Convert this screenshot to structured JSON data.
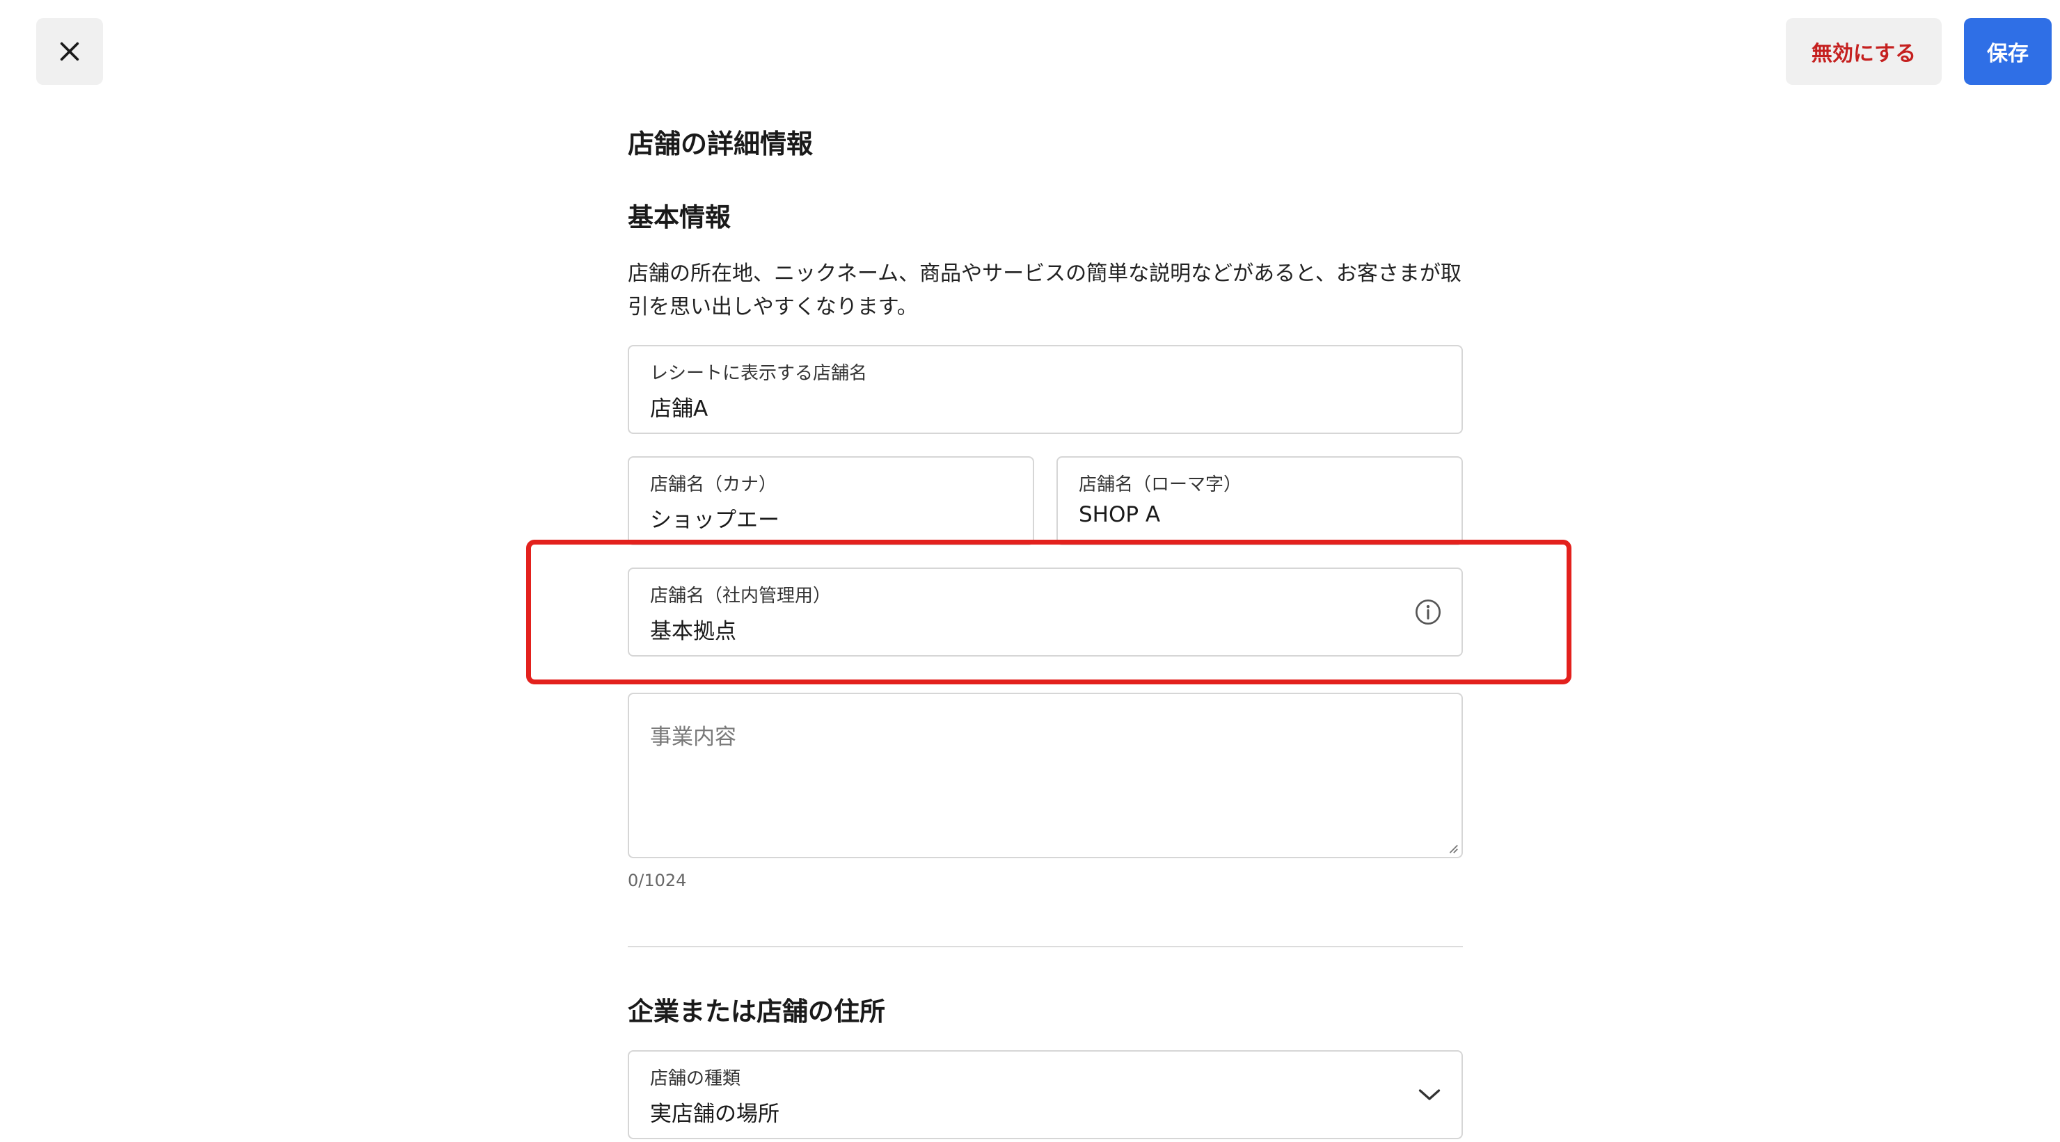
{
  "toolbar": {
    "close_icon": "close-icon",
    "disable_label": "無効にする",
    "save_label": "保存"
  },
  "page": {
    "title": "店舗の詳細情報"
  },
  "basic_info": {
    "title": "基本情報",
    "description": "店舗の所在地、ニックネーム、商品やサービスの簡単な説明などがあると、お客さまが取引を思い出しやすくなります。",
    "receipt_name": {
      "label": "レシートに表示する店舗名",
      "value": "店舗A"
    },
    "kana_name": {
      "label": "店舗名（カナ）",
      "value": "ショップエー"
    },
    "roman_name": {
      "label": "店舗名（ローマ字）",
      "value": "SHOP A"
    },
    "internal_name": {
      "label": "店舗名（社内管理用）",
      "value": "基本拠点",
      "icon": "info-icon"
    },
    "business_description": {
      "placeholder": "事業内容",
      "counter": "0/1024"
    }
  },
  "address": {
    "title": "企業または店舗の住所",
    "store_type": {
      "label": "店舗の種類",
      "value": "実店舗の場所",
      "icon": "chevron-down-icon"
    }
  },
  "colors": {
    "primary": "#2f6fe6",
    "danger": "#c5201f",
    "highlight": "#e3211d"
  }
}
